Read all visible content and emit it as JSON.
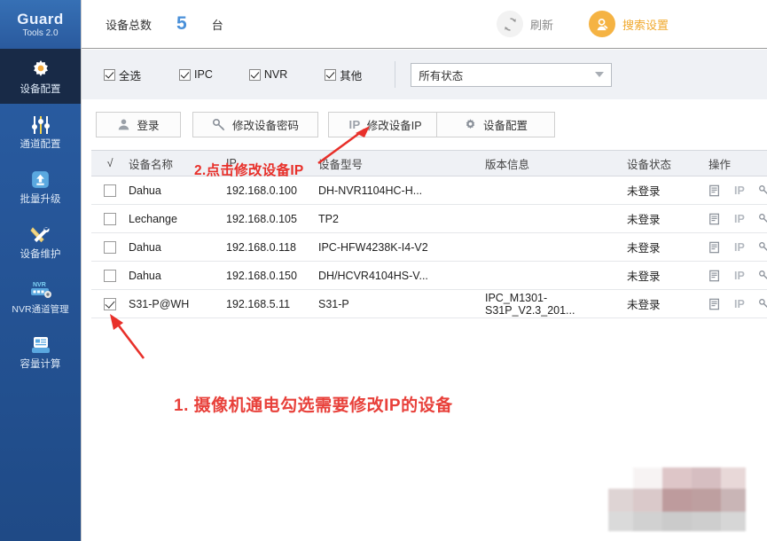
{
  "app": {
    "brand": "Guard",
    "version_label": "Tools 2.0"
  },
  "sidebar": {
    "items": [
      {
        "label": "设备配置",
        "icon": "gear-icon",
        "active": true
      },
      {
        "label": "通道配置",
        "icon": "sliders-icon",
        "active": false
      },
      {
        "label": "批量升级",
        "icon": "upload-icon",
        "active": false
      },
      {
        "label": "设备维护",
        "icon": "tools-icon",
        "active": false
      },
      {
        "label": "NVR通道管理",
        "icon": "nvr-icon",
        "active": false
      },
      {
        "label": "容量计算",
        "icon": "storage-icon",
        "active": false
      }
    ]
  },
  "topbar": {
    "total_label": "设备总数",
    "total_value": "5",
    "total_unit": "台",
    "refresh_label": "刷新",
    "refresh_icon": "refresh-icon",
    "search_setting_label": "搜索设置",
    "search_setting_icon": "search-person-icon",
    "accent_blue": "#4a90d9",
    "accent_orange": "#f0a92e"
  },
  "filters": {
    "checkboxes": [
      {
        "label": "全选",
        "checked": true
      },
      {
        "label": "IPC",
        "checked": true
      },
      {
        "label": "NVR",
        "checked": true
      },
      {
        "label": "其他",
        "checked": true
      }
    ],
    "status_select": {
      "value": "所有状态",
      "options": [
        "所有状态"
      ]
    }
  },
  "actions": [
    {
      "label": "登录",
      "icon": "user-icon"
    },
    {
      "label": "修改设备密码",
      "icon": "key-icon"
    },
    {
      "label": "修改设备IP",
      "icon": "ip-icon"
    },
    {
      "label": "设备配置",
      "icon": "gear-icon"
    }
  ],
  "table": {
    "headers": {
      "check": "√",
      "name": "设备名称",
      "ip": "IP",
      "model": "设备型号",
      "version": "版本信息",
      "status": "设备状态",
      "ops": "操作"
    },
    "op_icons": [
      "detail-icon",
      "ip-icon",
      "key-icon"
    ],
    "op_ip_label": "IP",
    "rows": [
      {
        "checked": false,
        "name": "Dahua",
        "ip": "192.168.0.100",
        "model": "DH-NVR1104HC-H...",
        "version": "",
        "status": "未登录"
      },
      {
        "checked": false,
        "name": "Lechange",
        "ip": "192.168.0.105",
        "model": "TP2",
        "version": "",
        "status": "未登录"
      },
      {
        "checked": false,
        "name": "Dahua",
        "ip": "192.168.0.118",
        "model": "IPC-HFW4238K-I4-V2",
        "version": "",
        "status": "未登录"
      },
      {
        "checked": false,
        "name": "Dahua",
        "ip": "192.168.0.150",
        "model": "DH/HCVR4104HS-V...",
        "version": "",
        "status": "未登录"
      },
      {
        "checked": true,
        "name": "S31-P@WH",
        "ip": "192.168.5.11",
        "model": "S31-P",
        "version": "IPC_M1301-S31P_V2.3_201...",
        "status": "未登录"
      }
    ]
  },
  "annotations": {
    "step1": "1. 摄像机通电勾选需要修改IP的设备",
    "step2": "2.点击修改设备IP",
    "color": "#e8302a"
  }
}
